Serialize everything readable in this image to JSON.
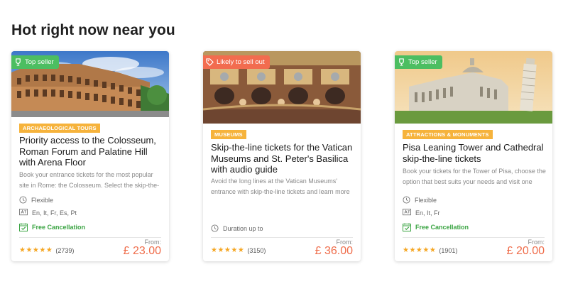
{
  "section": {
    "title": "Hot right now near you"
  },
  "colors": {
    "accent_price": "#ef6c4a",
    "category_tag": "#f6b33c",
    "top_seller_badge": "#4cbe61",
    "likely_sell_out_badge": "#f26c4f",
    "free_cancel": "#3aa442"
  },
  "cards": [
    {
      "image": "colosseum-photo",
      "badge": {
        "label": "Top seller",
        "icon": "trophy-icon"
      },
      "category": "Archaeological tours",
      "title": "Priority access to the Colosseum, Roman Forum and Palatine Hill with Arena Floor",
      "description": "Book your entrance tickets for the most popular site in Rome: the Colosseum. Select the skip-the-",
      "duration": "Flexible",
      "languages": "En, It, Fr, Es, Pt",
      "cancellation": "Free Cancellation",
      "rating": {
        "stars": 4.5,
        "count": "(2739)"
      },
      "from_label": "From:",
      "price": "£ 23.00"
    },
    {
      "image": "sistine-chapel-photo",
      "badge": {
        "label": "Likely to sell out",
        "icon": "tag-icon"
      },
      "category": "Museums",
      "title": "Skip-the-line tickets for the Vatican Museums and St. Peter's Basilica with audio guide",
      "description": "Avoid the long lines at the Vatican Museums' entrance with skip-the-line tickets and learn more",
      "duration": "Duration up to",
      "rating": {
        "stars": 4.5,
        "count": "(3150)"
      },
      "from_label": "From:",
      "price": "£ 36.00"
    },
    {
      "image": "pisa-photo",
      "badge": {
        "label": "Top seller",
        "icon": "trophy-icon"
      },
      "category": "Attractions & Monuments",
      "title": "Pisa Leaning Tower and Cathedral skip-the-line tickets",
      "description": "Book your tickets for the Tower of Pisa, choose the option that best suits your needs and visit one",
      "duration": "Flexible",
      "languages": "En, It, Fr",
      "cancellation": "Free Cancellation",
      "rating": {
        "stars": 4.5,
        "count": "(1901)"
      },
      "from_label": "From:",
      "price": "£ 20.00"
    }
  ]
}
